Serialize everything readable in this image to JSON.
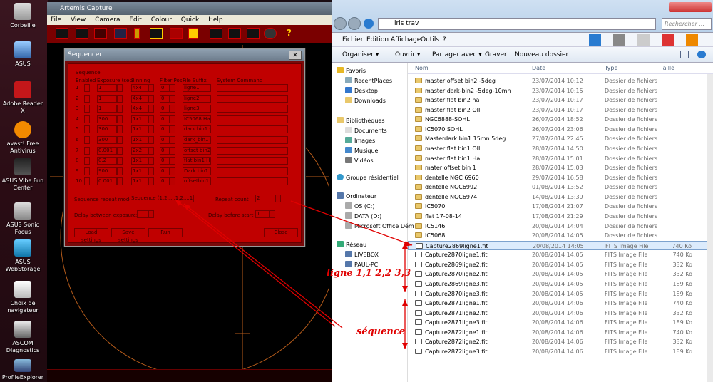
{
  "desktop": {
    "icons": [
      {
        "label": "Corbeille"
      },
      {
        "label": "ASUS"
      },
      {
        "label": "Adobe Reader X"
      },
      {
        "label": "avast! Free Antivirus"
      },
      {
        "label": "ASUS Vibe Fun Center"
      },
      {
        "label": "ASUS Sonic Focus"
      },
      {
        "label": "ASUS WebStorage"
      },
      {
        "label": "Choix de navigateur"
      },
      {
        "label": "ASCOM Diagnostics"
      },
      {
        "label": "ProfileExplorer"
      }
    ]
  },
  "artemis": {
    "title": "Artemis Capture",
    "menu": [
      "File",
      "View",
      "Camera",
      "Edit",
      "Colour",
      "Quick",
      "Help"
    ]
  },
  "sequencer": {
    "title": "Sequencer",
    "close_glyph": "✕",
    "section": "Sequence",
    "columns": [
      "Enabled",
      "Exposure (sec)",
      "Binning",
      "Filter Pos",
      "File Suffix",
      "System Command"
    ],
    "rows": [
      {
        "n": "1",
        "exposure": "1",
        "binning": "4x4",
        "filter": "0",
        "suffix": "ligne1"
      },
      {
        "n": "2",
        "exposure": "1",
        "binning": "4x4",
        "filter": "0",
        "suffix": "ligne2"
      },
      {
        "n": "3",
        "exposure": "1",
        "binning": "4x4",
        "filter": "0",
        "suffix": "ligne3"
      },
      {
        "n": "4",
        "exposure": "300",
        "binning": "1x1",
        "filter": "0",
        "suffix": "IC5068 Ha"
      },
      {
        "n": "5",
        "exposure": "300",
        "binning": "1x1",
        "filter": "0",
        "suffix": "dark bin1 -5"
      },
      {
        "n": "6",
        "exposure": "300",
        "binning": "1x1",
        "filter": "0",
        "suffix": "dark_bin1"
      },
      {
        "n": "7",
        "exposure": "0.001",
        "binning": "2x2",
        "filter": "0",
        "suffix": "offset bin2"
      },
      {
        "n": "8",
        "exposure": "0.2",
        "binning": "1x1",
        "filter": "0",
        "suffix": "flat bin1 Ha"
      },
      {
        "n": "9",
        "exposure": "900",
        "binning": "1x1",
        "filter": "0",
        "suffix": "Dark bin1 -5"
      },
      {
        "n": "10",
        "exposure": "0.001",
        "binning": "1x1",
        "filter": "0",
        "suffix": "offsetbin1"
      }
    ],
    "repeat_mode_label": "Sequence repeat mode",
    "repeat_mode_value": "Sequence (1,2,...,1,2,...1,2,...)",
    "repeat_count_label": "Repeat count",
    "repeat_count_value": "2",
    "delay_exposures_label": "Delay between exposures",
    "delay_exposures_value": "1",
    "delay_start_label": "Delay before start",
    "delay_start_value": "1",
    "load_label": "Load settings",
    "save_label": "Save settings",
    "run_label": "Run",
    "close_label": "Close"
  },
  "explorer": {
    "path": "iris trav",
    "search_placeholder": "Rechercher ...",
    "menu": [
      "Fichier",
      "Edition",
      "Affichage",
      "Outils",
      "?"
    ],
    "commands": [
      "Organiser ▾",
      "Ouvrir ▾",
      "Partager avec ▾",
      "Graver",
      "Nouveau dossier"
    ],
    "nav": {
      "favoris": "Favoris",
      "favoris_items": [
        "RecentPlaces",
        "Desktop",
        "Downloads"
      ],
      "bibliotheques": "Bibliothèques",
      "bibliotheques_items": [
        "Documents",
        "Images",
        "Musique",
        "Vidéos"
      ],
      "groupe": "Groupe résidentiel",
      "ordinateur": "Ordinateur",
      "ordinateur_items": [
        "OS (C:)",
        "DATA (D:)",
        "Microsoft Office Dém"
      ],
      "reseau": "Réseau",
      "reseau_items": [
        "LIVEBOX",
        "PAUL-PC"
      ]
    },
    "columns": [
      "Nom",
      "Date",
      "Type",
      "Taille"
    ],
    "files": [
      {
        "name": "master offset bin2 -5deg",
        "date": "23/07/2014 10:12",
        "type": "Dossier de fichiers",
        "size": "",
        "kind": "folder"
      },
      {
        "name": "master dark-bin2 -5deg-10mn",
        "date": "23/07/2014 10:15",
        "type": "Dossier de fichiers",
        "size": "",
        "kind": "folder"
      },
      {
        "name": "master flat bin2 ha",
        "date": "23/07/2014 10:17",
        "type": "Dossier de fichiers",
        "size": "",
        "kind": "folder"
      },
      {
        "name": "master flat bin2 OIII",
        "date": "23/07/2014 10:17",
        "type": "Dossier de fichiers",
        "size": "",
        "kind": "folder"
      },
      {
        "name": "NGC6888-SOHL",
        "date": "26/07/2014 18:52",
        "type": "Dossier de fichiers",
        "size": "",
        "kind": "folder"
      },
      {
        "name": "IC5070 SOHL",
        "date": "26/07/2014 23:06",
        "type": "Dossier de fichiers",
        "size": "",
        "kind": "folder"
      },
      {
        "name": "Masterdark bin1  15mn 5deg",
        "date": "27/07/2014 22:45",
        "type": "Dossier de fichiers",
        "size": "",
        "kind": "folder"
      },
      {
        "name": "master flat bin1 OIII",
        "date": "28/07/2014 14:50",
        "type": "Dossier de fichiers",
        "size": "",
        "kind": "folder"
      },
      {
        "name": "master flat bin1 Ha",
        "date": "28/07/2014 15:01",
        "type": "Dossier de fichiers",
        "size": "",
        "kind": "folder"
      },
      {
        "name": "mater offset bin 1",
        "date": "28/07/2014 15:03",
        "type": "Dossier de fichiers",
        "size": "",
        "kind": "folder"
      },
      {
        "name": "dentelle NGC 6960",
        "date": "29/07/2014 16:58",
        "type": "Dossier de fichiers",
        "size": "",
        "kind": "folder"
      },
      {
        "name": "dentelle NGC6992",
        "date": "01/08/2014 13:52",
        "type": "Dossier de fichiers",
        "size": "",
        "kind": "folder"
      },
      {
        "name": "dentelle NGC6974",
        "date": "14/08/2014 13:39",
        "type": "Dossier de fichiers",
        "size": "",
        "kind": "folder"
      },
      {
        "name": "IC5070",
        "date": "17/08/2014 21:07",
        "type": "Dossier de fichiers",
        "size": "",
        "kind": "folder"
      },
      {
        "name": "flat 17-08-14",
        "date": "17/08/2014 21:29",
        "type": "Dossier de fichiers",
        "size": "",
        "kind": "folder"
      },
      {
        "name": "IC5146",
        "date": "20/08/2014 14:04",
        "type": "Dossier de fichiers",
        "size": "",
        "kind": "folder"
      },
      {
        "name": "IC5068",
        "date": "20/08/2014 14:05",
        "type": "Dossier de fichiers",
        "size": "",
        "kind": "folder"
      },
      {
        "name": "Capture2869ligne1.fit",
        "date": "20/08/2014 14:05",
        "type": "FITS Image File",
        "size": "740 Ko",
        "kind": "fits"
      },
      {
        "name": "Capture2870ligne1.fit",
        "date": "20/08/2014 14:05",
        "type": "FITS Image File",
        "size": "740 Ko",
        "kind": "fits"
      },
      {
        "name": "Capture2869ligne2.fit",
        "date": "20/08/2014 14:05",
        "type": "FITS Image File",
        "size": "332 Ko",
        "kind": "fits"
      },
      {
        "name": "Capture2870ligne2.fit",
        "date": "20/08/2014 14:05",
        "type": "FITS Image File",
        "size": "332 Ko",
        "kind": "fits"
      },
      {
        "name": "Capture2869ligne3.fit",
        "date": "20/08/2014 14:05",
        "type": "FITS Image File",
        "size": "189 Ko",
        "kind": "fits"
      },
      {
        "name": "Capture2870ligne3.fit",
        "date": "20/08/2014 14:05",
        "type": "FITS Image File",
        "size": "189 Ko",
        "kind": "fits"
      },
      {
        "name": "Capture2871ligne1.fit",
        "date": "20/08/2014 14:06",
        "type": "FITS Image File",
        "size": "740 Ko",
        "kind": "fits"
      },
      {
        "name": "Capture2871ligne2.fit",
        "date": "20/08/2014 14:06",
        "type": "FITS Image File",
        "size": "332 Ko",
        "kind": "fits"
      },
      {
        "name": "Capture2871ligne3.fit",
        "date": "20/08/2014 14:06",
        "type": "FITS Image File",
        "size": "189 Ko",
        "kind": "fits"
      },
      {
        "name": "Capture2872ligne1.fit",
        "date": "20/08/2014 14:06",
        "type": "FITS Image File",
        "size": "740 Ko",
        "kind": "fits"
      },
      {
        "name": "Capture2872ligne2.fit",
        "date": "20/08/2014 14:06",
        "type": "FITS Image File",
        "size": "332 Ko",
        "kind": "fits"
      },
      {
        "name": "Capture2872ligne3.fit",
        "date": "20/08/2014 14:06",
        "type": "FITS Image File",
        "size": "189 Ko",
        "kind": "fits"
      }
    ]
  },
  "annotations": {
    "lignes": "ligne 1,1  2,2  3,3",
    "sequence": "séquence",
    "color": "#e00000"
  }
}
